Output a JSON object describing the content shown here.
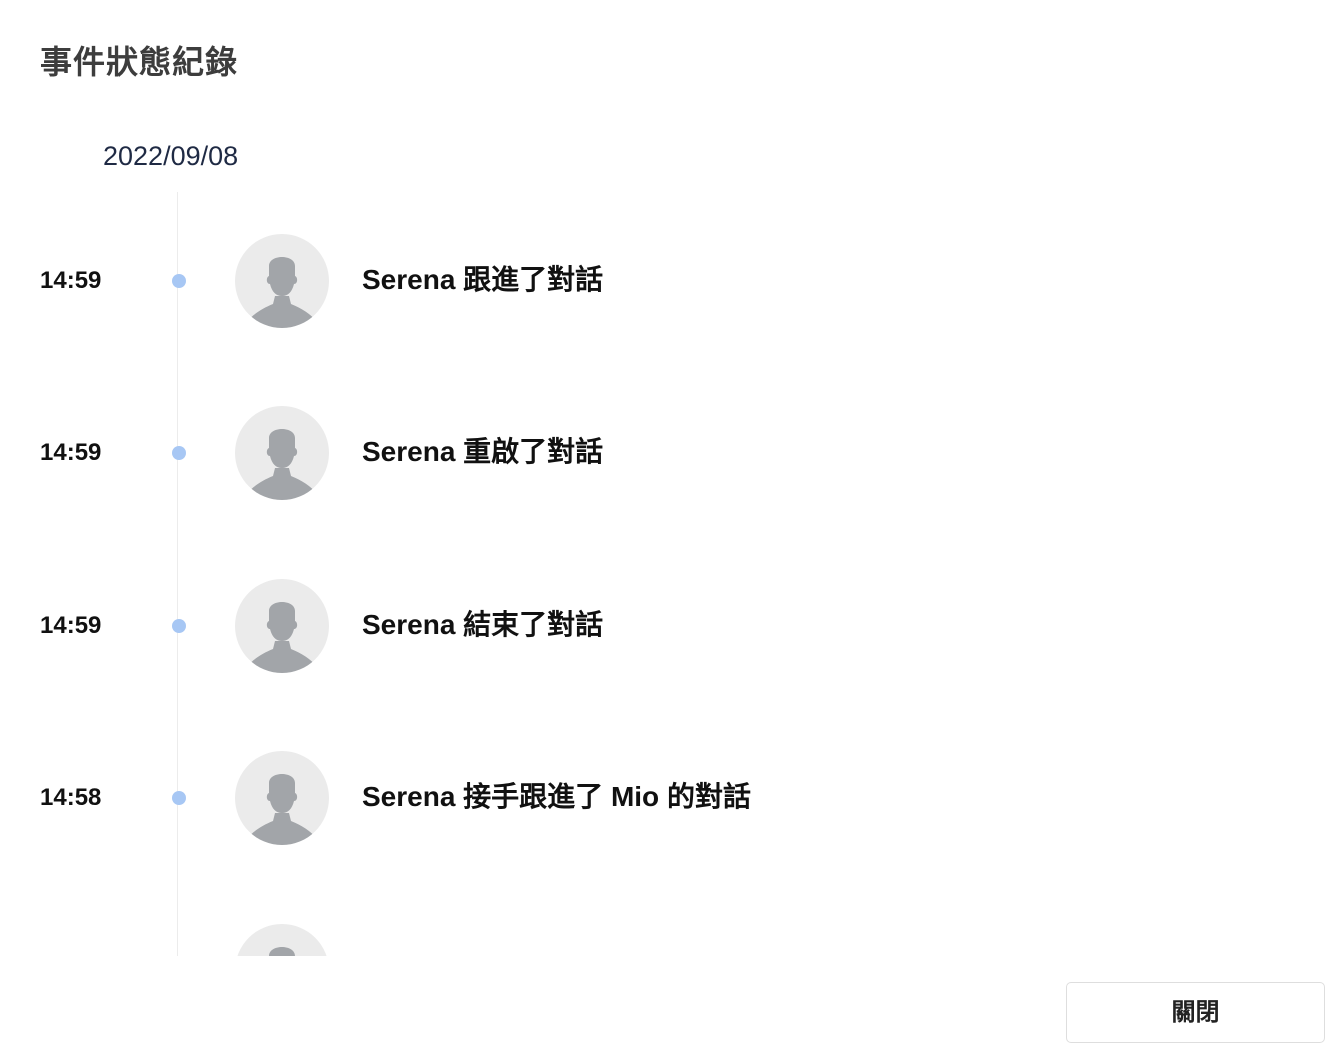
{
  "modal": {
    "title": "事件狀態紀錄",
    "close_label": "關閉"
  },
  "timeline": {
    "date": "2022/09/08",
    "events": [
      {
        "time": "14:59",
        "text": "Serena 跟進了對話",
        "avatar_icon": "default-user-avatar-icon"
      },
      {
        "time": "14:59",
        "text": "Serena 重啟了對話",
        "avatar_icon": "default-user-avatar-icon"
      },
      {
        "time": "14:59",
        "text": "Serena 結束了對話",
        "avatar_icon": "default-user-avatar-icon"
      },
      {
        "time": "14:58",
        "text": "Serena 接手跟進了 Mio 的對話",
        "avatar_icon": "default-user-avatar-icon"
      },
      {
        "time": "",
        "text": "",
        "avatar_icon": "default-user-avatar-icon"
      }
    ]
  },
  "colors": {
    "timeline_dot": "#a7c7f4",
    "avatar_background": "#ebebeb",
    "avatar_silhouette": "#a2a5a9",
    "date_text": "#1f2a44",
    "title_text": "#3d3d3d"
  }
}
